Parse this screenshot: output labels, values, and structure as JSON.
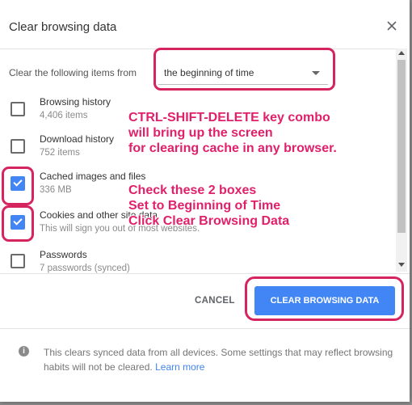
{
  "dialog": {
    "title": "Clear browsing data",
    "range_label": "Clear the following items from",
    "range_value": "the beginning of time"
  },
  "items": [
    {
      "label": "Browsing history",
      "sub": "4,406 items",
      "checked": false
    },
    {
      "label": "Download history",
      "sub": "752 items",
      "checked": false
    },
    {
      "label": "Cached images and files",
      "sub": "336 MB",
      "checked": true
    },
    {
      "label": "Cookies and other site data",
      "sub": "This will sign you out of most websites.",
      "checked": true
    },
    {
      "label": "Passwords",
      "sub": "7 passwords (synced)",
      "checked": false
    }
  ],
  "buttons": {
    "cancel": "CANCEL",
    "clear": "CLEAR BROWSING DATA"
  },
  "footer": {
    "info_icon": "i",
    "text": "This clears synced data from all devices. Some settings that may reflect browsing habits will not be cleared.",
    "link": "Learn more"
  },
  "annotations": {
    "block1": [
      "CTRL-SHIFT-DELETE key combo",
      "will bring up the screen",
      "for clearing cache in any browser."
    ],
    "block2": [
      "Check these 2 boxes",
      "Set to Beginning of Time",
      "Click Clear Browsing Data"
    ]
  },
  "colors": {
    "accent": "#4285f4",
    "annotation": "#e0206a",
    "highlight": "#d6245f"
  }
}
